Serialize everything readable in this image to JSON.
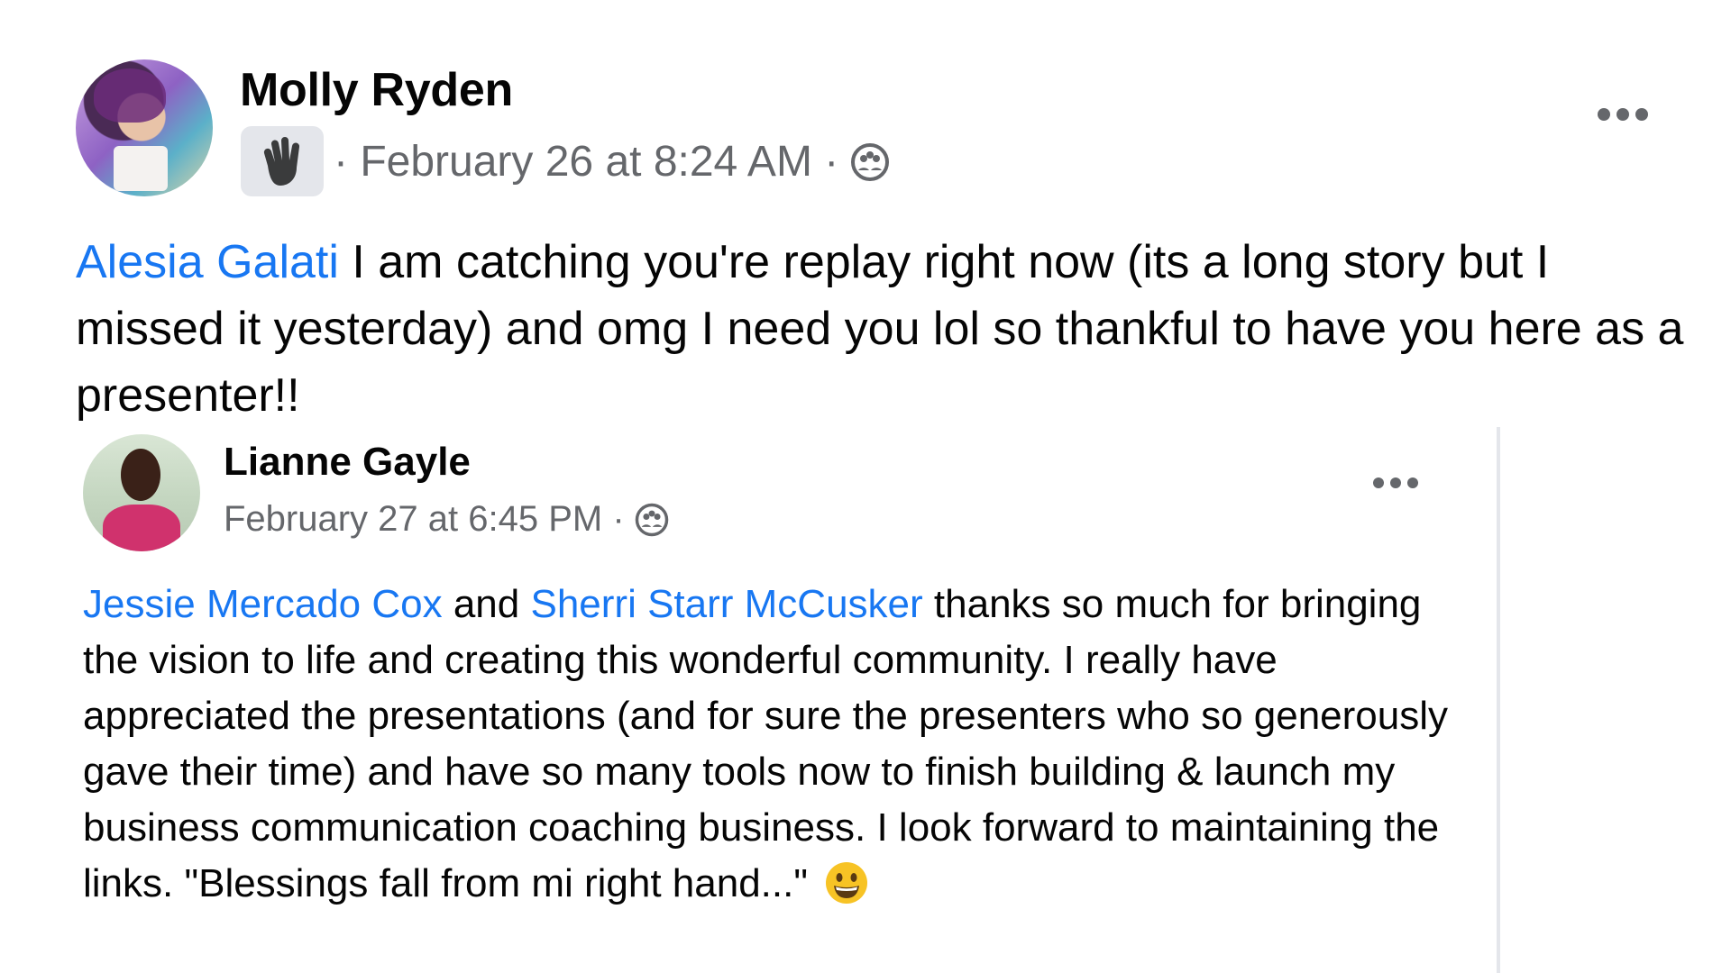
{
  "post": {
    "author": "Molly Ryden",
    "timestamp": "· February 26 at 8:24 AM ·",
    "badge_icon": "wave-hand-icon",
    "privacy_icon": "group-privacy-icon",
    "mention": "Alesia Galati",
    "text": " I am catching you're replay right now (its a long story but I missed it yesterday) and omg I need you lol so thankful to have you here as a presenter!!"
  },
  "shared_post": {
    "author": "Lianne Gayle",
    "timestamp": "February 27 at 6:45 PM ·",
    "privacy_icon": "group-privacy-icon",
    "mention_1": "Jessie Mercado Cox",
    "connector": " and ",
    "mention_2": "Sherri Starr McCusker",
    "text": " thanks so much for bringing the vision to life and creating this wonderful community. I really have appreciated the presentations (and for sure the presenters who so generously gave their time) and have so many tools now to finish building & launch my business communication coaching business. I look forward to maintaining the links. \"Blessings fall from mi right hand...\"",
    "emoji": "grinning-face"
  },
  "colors": {
    "mention": "#1877f2",
    "meta": "#65676b",
    "text": "#050505"
  }
}
